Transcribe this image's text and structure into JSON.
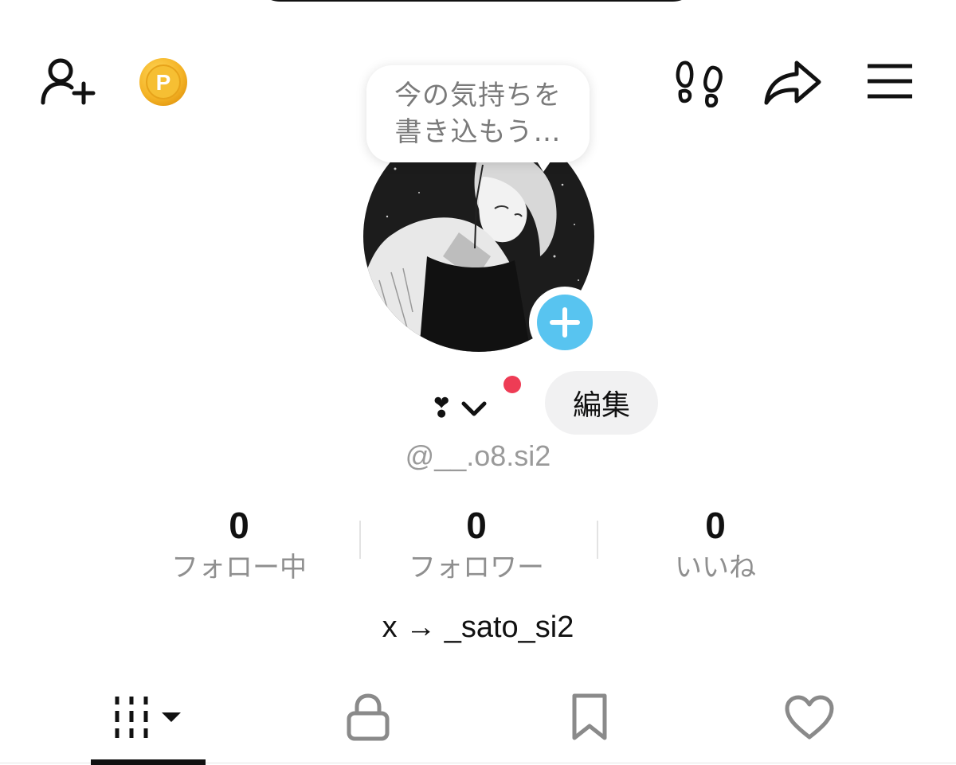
{
  "header": {
    "icons": {
      "add_friend": "person-add-icon",
      "coins": "coin-icon",
      "coin_letter": "P",
      "visitors": "footprints-icon",
      "share": "share-arrow-icon",
      "menu": "hamburger-menu-icon"
    }
  },
  "mood_bubble": {
    "text": "今の気持ちを\n書き込もう…"
  },
  "profile": {
    "avatar_icon": "avatar-image",
    "add_photo_icon": "plus-icon",
    "display_name": "❣",
    "edit_label": "編集",
    "username": "@__.o8.si2",
    "bio": "x → _sato_si2"
  },
  "stats": [
    {
      "value": "0",
      "label": "フォロー中"
    },
    {
      "value": "0",
      "label": "フォロワー"
    },
    {
      "value": "0",
      "label": "いいね"
    }
  ],
  "tabs": [
    {
      "icon": "videos-grid-icon",
      "active": true
    },
    {
      "icon": "lock-icon",
      "active": false
    },
    {
      "icon": "bookmark-icon",
      "active": false
    },
    {
      "icon": "heart-icon",
      "active": false
    }
  ],
  "colors": {
    "accent_blue": "#58c4f0",
    "coin_gold": "#f4b326",
    "notification_red": "#ee3c55",
    "muted_text": "#8f8f8f"
  }
}
